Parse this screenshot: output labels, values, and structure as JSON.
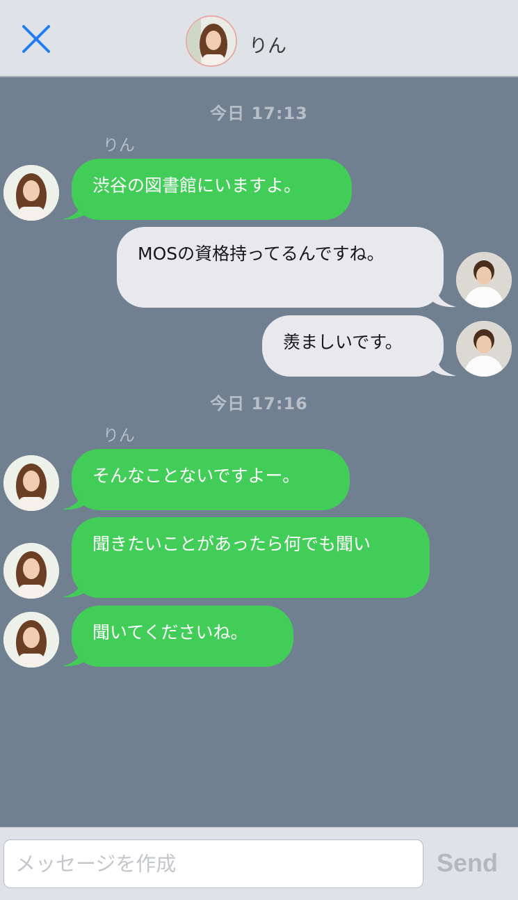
{
  "header": {
    "contact_name": "りん",
    "close_icon": "close-icon",
    "accent_color": "#1f7cf5"
  },
  "chat": {
    "groups": [
      {
        "timestamp": "今日 17:13",
        "sender": "りん"
      },
      {
        "timestamp": "今日 17:16",
        "sender": "りん"
      }
    ],
    "messages": [
      {
        "direction": "incoming",
        "text": "渋谷の図書館にいますよ。"
      },
      {
        "direction": "outgoing",
        "text": "MOSの資格持ってるんですね。"
      },
      {
        "direction": "outgoing",
        "text": "羨ましいです。"
      },
      {
        "direction": "incoming",
        "text": "そんなことないですよー。"
      },
      {
        "direction": "incoming",
        "text": "聞きたいことがあったら何でも聞い"
      },
      {
        "direction": "incoming",
        "text": "聞いてくださいね。"
      }
    ],
    "incoming_color": "#41cd57",
    "outgoing_color": "#e8e8ed"
  },
  "composer": {
    "placeholder": "メッセージを作成",
    "value": "",
    "send_label": "Send"
  }
}
